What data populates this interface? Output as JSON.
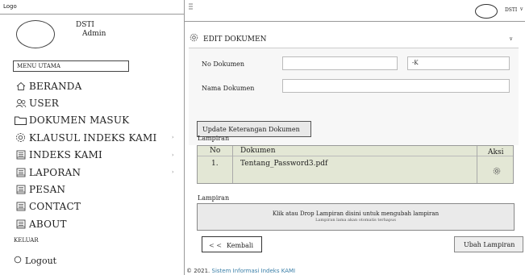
{
  "sidebar": {
    "logo": "Logo",
    "user_name": "DSTI",
    "user_role": "Admin",
    "menu_title": "MENU UTAMA",
    "items": [
      {
        "label": "BERANDA",
        "icon": "home-icon"
      },
      {
        "label": "USER",
        "icon": "users-icon"
      },
      {
        "label": "DOKUMEN MASUK",
        "icon": "folder-icon"
      },
      {
        "label": "KLAUSUL INDEKS KAMI",
        "icon": "gear-icon",
        "chevron": "›"
      },
      {
        "label": "INDEKS KAMI",
        "icon": "document-icon",
        "chevron": "›"
      },
      {
        "label": "LAPORAN",
        "icon": "document-icon",
        "chevron": "›"
      },
      {
        "label": "PESAN",
        "icon": "document-icon"
      },
      {
        "label": "CONTACT",
        "icon": "document-icon"
      },
      {
        "label": "ABOUT",
        "icon": "document-icon"
      }
    ],
    "keluar": "KELUAR",
    "logout": "Logout"
  },
  "topbar": {
    "user": "DSTI",
    "chevron": "v"
  },
  "panel": {
    "title": "EDIT DOKUMEN",
    "chevron": "v",
    "no_dokumen_label": "No Dokumen",
    "no_dokumen_suffix": "-K",
    "nama_dokumen_label": "Nama Dokumen",
    "update_button": "Update Keterangan Dokumen",
    "lampiran_label": "Lampiran",
    "table": {
      "headers": [
        "No",
        "Dokumen",
        "Aksi"
      ],
      "rows": [
        {
          "no": "1.",
          "dokumen": "Tentang_Password3.pdf"
        }
      ]
    },
    "lampiran_label_2": "Lampiran",
    "dropzone_main": "Klik atau Drop Lampiran disini untuk mengubah lampiran",
    "dropzone_sub": "Lampiran lama akan otomatis terhapus",
    "back_button": "Kembali",
    "back_arrows": "< <",
    "save_button": "Ubah Lampiran"
  },
  "footer": {
    "prefix": "© 2021.",
    "brand": "Sistem Informasi Indeks KAMI"
  }
}
